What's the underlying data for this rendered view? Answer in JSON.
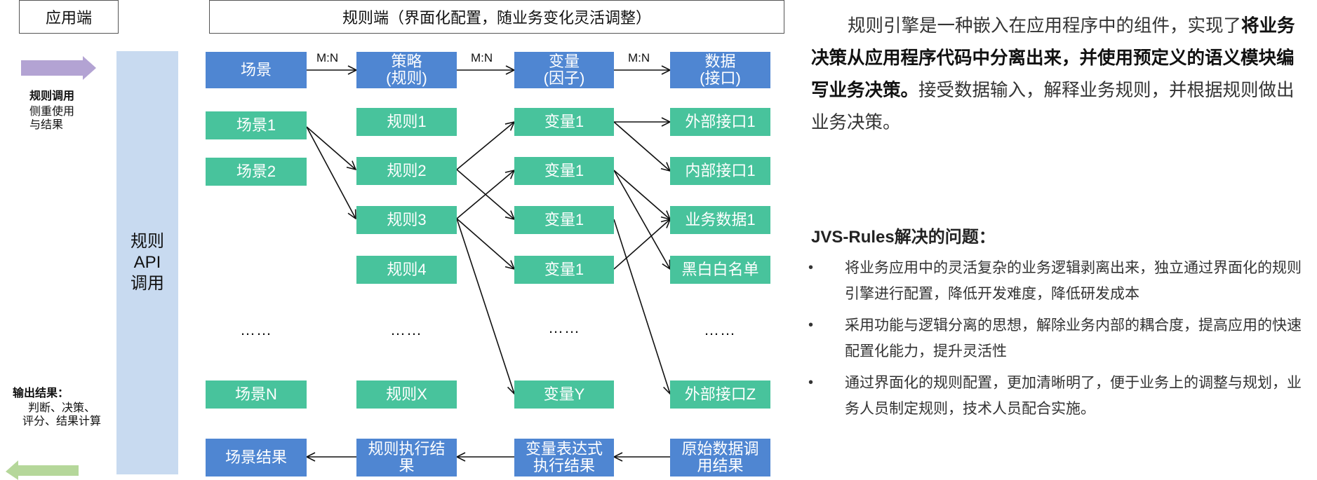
{
  "header": {
    "app_side": "应用端",
    "rule_side": "规则端（界面化配置，随业务变化灵活调整）"
  },
  "left_panel": {
    "rule_call_title": "规则调用",
    "rule_call_desc": "侧重使用\n与结果",
    "output_title": "输出结果：",
    "output_desc": "判断、决策、\n评分、结果计算",
    "api_bar": "规则\nAPI\n调用",
    "in_arrow_color": "#b3a3d3",
    "out_arrow_color": "#b5d79a"
  },
  "diagram": {
    "header_row": [
      "场景",
      "策略\n(规则)",
      "变量\n(因子)",
      "数据\n(接口)"
    ],
    "relations": [
      "M:N",
      "M:N",
      "M:N"
    ],
    "scenes": [
      "场景1",
      "场景2",
      "场景N"
    ],
    "rules": [
      "规则1",
      "规则2",
      "规则3",
      "规则4",
      "规则X"
    ],
    "variables": [
      "变量1",
      "变量1",
      "变量1",
      "变量1",
      "变量Y"
    ],
    "data_items": [
      "外部接口1",
      "内部接口1",
      "业务数据1",
      "黑白白名单",
      "外部接口Z"
    ],
    "ellipsis": "……",
    "results": [
      "场景结果",
      "规则执行结\n果",
      "变量表达式\n执行结果",
      "原始数据调\n用结果"
    ],
    "colors": {
      "header_blue": "#4f86d2",
      "item_green": "#48c39c",
      "api_bar": "#c8daf0"
    }
  },
  "intro": {
    "part1": "规则引擎是一种嵌入在应用程序中的组件，实现了",
    "part2_bold": "将业务决策从应用程序代码中分离出来，并使用预定义的语义模块编写业务决策。",
    "part3": "接受数据输入，解释业务规则，并根据规则做出业务决策。"
  },
  "problems": {
    "title": "JVS-Rules解决的问题：",
    "bullet": "•",
    "items": [
      "将业务应用中的灵活复杂的业务逻辑剥离出来，独立通过界面化的规则引擎进行配置，降低开发难度，降低研发成本",
      "采用功能与逻辑分离的思想，解除业务内部的耦合度，提高应用的快速配置化能力，提升灵活性",
      "通过界面化的规则配置，更加清晰明了，便于业务上的调整与规划，业务人员制定规则，技术人员配合实施。"
    ]
  }
}
